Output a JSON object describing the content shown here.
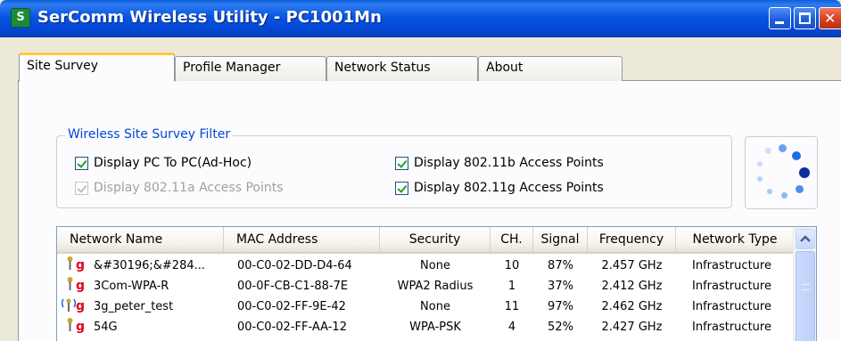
{
  "window": {
    "title": "SerComm Wireless Utility - PC1001Mn",
    "app_icon_glyph": "S",
    "colors": {
      "titlebar": "#0955e3",
      "close_button": "#d6401d",
      "active_tab_accent": "#ffc83c",
      "group_label": "#0046d5",
      "signal_g": "#e0001a"
    }
  },
  "tabs": [
    {
      "label": "Site Survey",
      "active": true
    },
    {
      "label": "Profile Manager",
      "active": false
    },
    {
      "label": "Network Status",
      "active": false
    },
    {
      "label": "About",
      "active": false
    }
  ],
  "filter": {
    "legend": "Wireless Site Survey Filter",
    "options": {
      "adhoc": {
        "label": "Display PC To PC(Ad-Hoc)",
        "checked": true,
        "enabled": true
      },
      "b": {
        "label": "Display 802.11b Access Points",
        "checked": true,
        "enabled": true
      },
      "a": {
        "label": "Display 802.11a Access Points",
        "checked": true,
        "enabled": false
      },
      "g": {
        "label": "Display 802.11g Access Points",
        "checked": true,
        "enabled": true
      }
    }
  },
  "networks": {
    "columns": [
      "Network Name",
      "MAC Address",
      "Security",
      "CH.",
      "Signal",
      "Frequency",
      "Network Type"
    ],
    "rows": [
      {
        "icon": "antenna-icon",
        "mode": "g",
        "name": "&#30196;&#284...",
        "mac": "00-C0-02-DD-D4-64",
        "security": "None",
        "channel": "10",
        "signal": "87%",
        "frequency": "2.457 GHz",
        "type": "Infrastructure"
      },
      {
        "icon": "antenna-icon",
        "mode": "g",
        "name": "3Com-WPA-R",
        "mac": "00-0F-CB-C1-88-7E",
        "security": "WPA2 Radius",
        "channel": "1",
        "signal": "37%",
        "frequency": "2.412 GHz",
        "type": "Infrastructure"
      },
      {
        "icon": "connected-antenna-icon",
        "mode": "g",
        "name": "3g_peter_test",
        "mac": "00-C0-02-FF-9E-42",
        "security": "None",
        "channel": "11",
        "signal": "97%",
        "frequency": "2.462 GHz",
        "type": "Infrastructure"
      },
      {
        "icon": "antenna-icon",
        "mode": "g",
        "name": "54G",
        "mac": "00-C0-02-FF-AA-12",
        "security": "WPA-PSK",
        "channel": "4",
        "signal": "52%",
        "frequency": "2.427 GHz",
        "type": "Infrastructure"
      }
    ]
  }
}
